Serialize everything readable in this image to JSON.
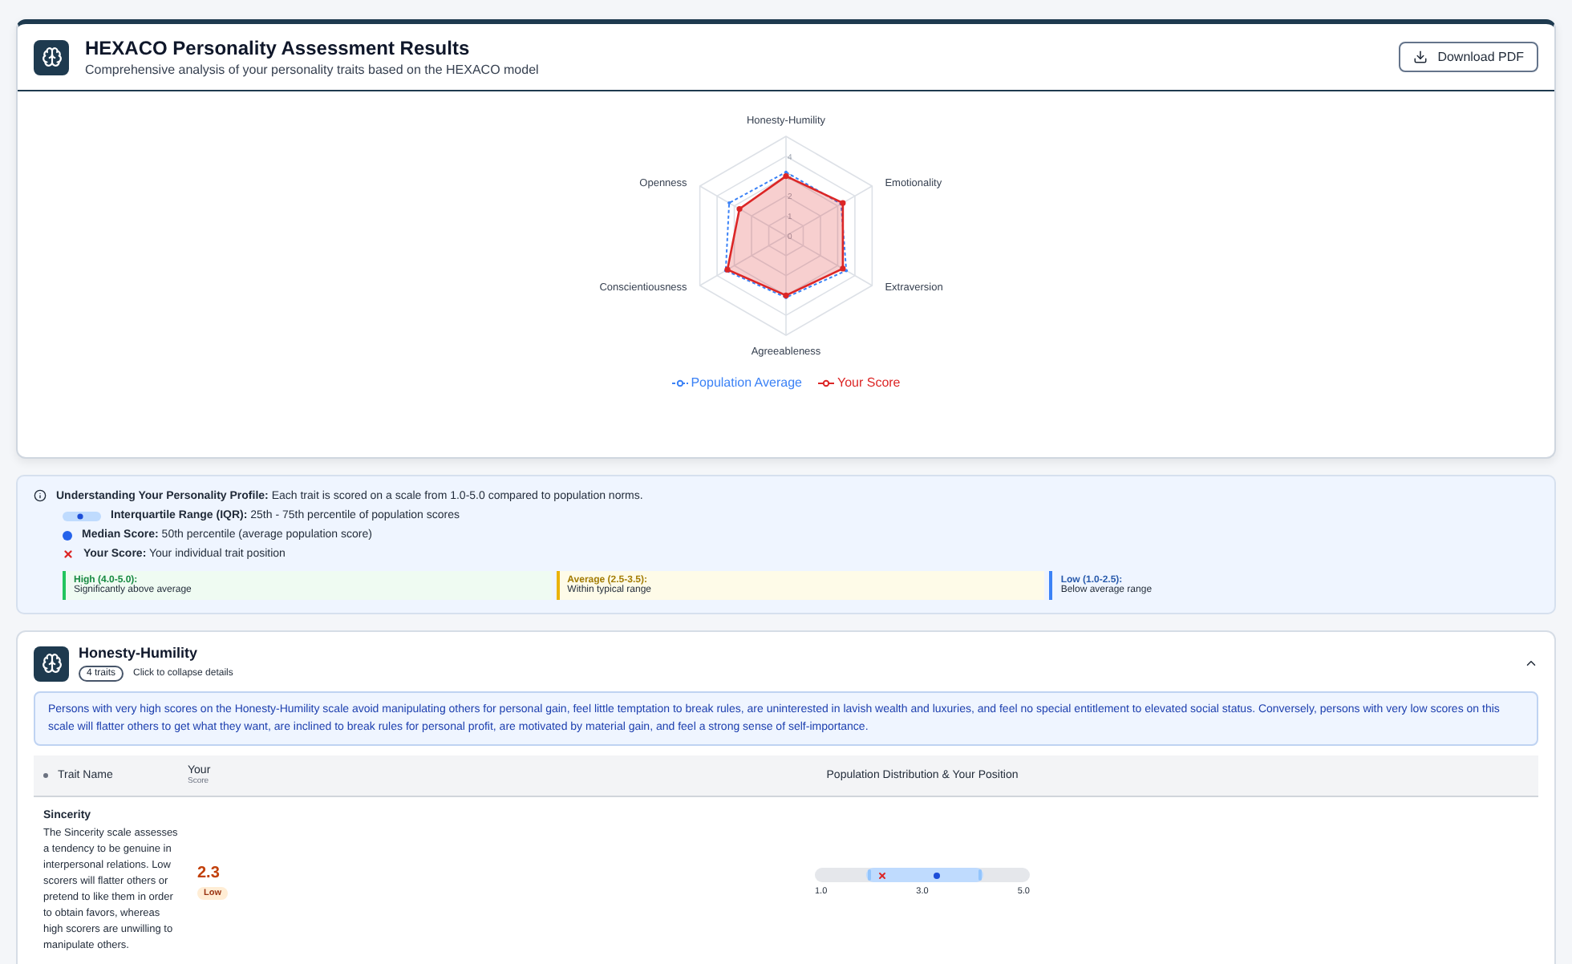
{
  "header": {
    "title": "HEXACO Personality Assessment Results",
    "subtitle": "Comprehensive analysis of your personality traits based on the HEXACO model",
    "download_button": "Download PDF"
  },
  "chart_data": {
    "type": "radar",
    "categories": [
      "Honesty-Humility",
      "Emotionality",
      "Extraversion",
      "Agreeableness",
      "Conscientiousness",
      "Openness"
    ],
    "yticks": [
      0,
      1,
      2,
      3,
      4
    ],
    "ylim": [
      0,
      5
    ],
    "series": [
      {
        "name": "Population Average",
        "color": "#3b82f6",
        "values": [
          3.2,
          3.2,
          3.5,
          3.1,
          3.5,
          3.3
        ]
      },
      {
        "name": "Your Score",
        "color": "#dc2626",
        "values": [
          3.0,
          3.3,
          3.3,
          3.0,
          3.4,
          2.7
        ]
      }
    ]
  },
  "info": {
    "heading": "Understanding Your Personality Profile:",
    "text": "Each trait is scored on a scale from 1.0-5.0 compared to population norms.",
    "legend": [
      {
        "kind": "iqr",
        "label": "Interquartile Range (IQR):",
        "text": "25th - 75th percentile of population scores"
      },
      {
        "kind": "median",
        "label": "Median Score:",
        "text": "50th percentile (average population score)"
      },
      {
        "kind": "score",
        "label": "Your Score:",
        "text": "Your individual trait position"
      }
    ],
    "ranges": [
      {
        "label": "High (4.0-5.0):",
        "text": "Significantly above average",
        "color": "#22c55e"
      },
      {
        "label": "Average (2.5-3.5):",
        "text": "Within typical range",
        "color": "#eab308"
      },
      {
        "label": "Low (1.0-2.5):",
        "text": "Below average range",
        "color": "#3b82f6"
      }
    ]
  },
  "section": {
    "title": "Honesty-Humility",
    "count": "4 traits",
    "hint": "Click to collapse details",
    "expanded": true,
    "description": "Persons with very high scores on the Honesty-Humility scale avoid manipulating others for personal gain, feel little temptation to break rules, are uninterested in lavish wealth and luxuries, and feel no special entitlement to elevated social status. Conversely, persons with very low scores on this scale will flatter others to get what they want, are inclined to break rules for personal profit, are motivated by material gain, and feel a strong sense of self-importance.",
    "columns": {
      "name": "Trait Name",
      "score": "Your",
      "score_sub": "Score",
      "distribution": "Population Distribution & Your Position"
    },
    "traits": [
      {
        "name": "Sincerity",
        "description": "The Sincerity scale assesses a tendency to be genuine in interpersonal relations. Low scorers will flatter others or pretend to like them in order to obtain favors, whereas high scorers are unwilling to manipulate others.",
        "score": "2.3",
        "band": "Low",
        "kind": "low",
        "iqr": {
          "low": {
            "level": 0.24
          },
          "high": {
            "level": 0.78
          }
        },
        "median": {
          "level": 0.57
        },
        "you": {
          "level": 0.31
        },
        "ticks": [
          "1.0",
          "3.0",
          "5.0"
        ]
      }
    ]
  }
}
